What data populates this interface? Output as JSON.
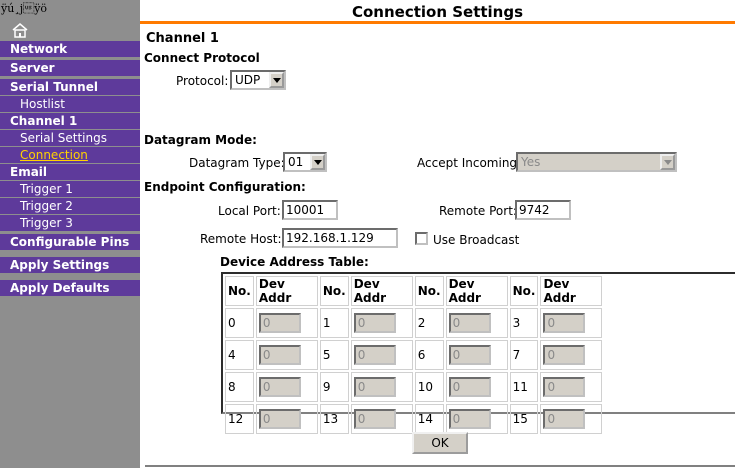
{
  "sidebar": {
    "logo_text": "ÿú¸j\u001fÿö",
    "nav": {
      "network": "Network",
      "server": "Server",
      "serial_tunnel": "Serial Tunnel",
      "hostlist": "Hostlist",
      "channel_1": "Channel 1",
      "serial_settings": "Serial Settings",
      "connection": "Connection",
      "email": "Email",
      "trigger_1": "Trigger 1",
      "trigger_2": "Trigger 2",
      "trigger_3": "Trigger 3",
      "configurable_pins": "Configurable Pins",
      "apply_settings": "Apply Settings",
      "apply_defaults": "Apply Defaults"
    },
    "active_item": "connection",
    "colors": {
      "background": "#8e8e8e",
      "nav": "#5e3a9b",
      "active": "#ffd200"
    }
  },
  "page": {
    "title": "Connection Settings",
    "accent_color": "#ff7a00",
    "channel_heading": "Channel 1",
    "connect_protocol_heading": "Connect Protocol",
    "protocol_label": "Protocol:",
    "protocol_value": "UDP",
    "datagram_mode_heading": "Datagram Mode:",
    "datagram_type_label": "Datagram Type:",
    "datagram_type_value": "01",
    "accept_incoming_label": "Accept Incoming:",
    "accept_incoming_value": "Yes",
    "endpoint_heading": "Endpoint Configuration:",
    "local_port_label": "Local Port:",
    "local_port_value": "10001",
    "remote_port_label": "Remote Port:",
    "remote_port_value": "9742",
    "remote_host_label": "Remote Host:",
    "remote_host_value": "192.168.1.129",
    "use_broadcast_label": "Use Broadcast",
    "use_broadcast_checked": false,
    "device_table_heading": "Device Address Table:",
    "device_table": {
      "headers": [
        "No.",
        "Dev Addr",
        "No.",
        "Dev Addr",
        "No.",
        "Dev Addr",
        "No.",
        "Dev Addr"
      ],
      "rows": [
        [
          {
            "no": "0",
            "addr": "0"
          },
          {
            "no": "1",
            "addr": "0"
          },
          {
            "no": "2",
            "addr": "0"
          },
          {
            "no": "3",
            "addr": "0"
          }
        ],
        [
          {
            "no": "4",
            "addr": "0"
          },
          {
            "no": "5",
            "addr": "0"
          },
          {
            "no": "6",
            "addr": "0"
          },
          {
            "no": "7",
            "addr": "0"
          }
        ],
        [
          {
            "no": "8",
            "addr": "0"
          },
          {
            "no": "9",
            "addr": "0"
          },
          {
            "no": "10",
            "addr": "0"
          },
          {
            "no": "11",
            "addr": "0"
          }
        ],
        [
          {
            "no": "12",
            "addr": "0"
          },
          {
            "no": "13",
            "addr": "0"
          },
          {
            "no": "14",
            "addr": "0"
          },
          {
            "no": "15",
            "addr": "0"
          }
        ]
      ]
    },
    "ok_label": "OK"
  }
}
